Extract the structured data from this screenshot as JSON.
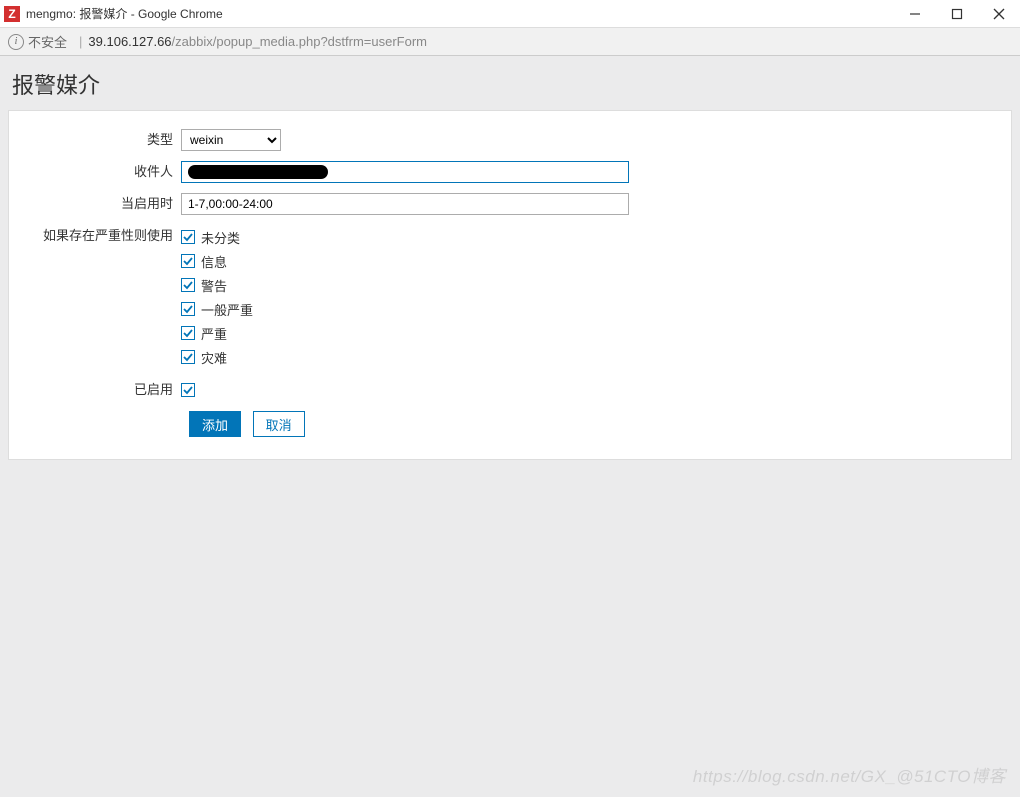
{
  "window": {
    "title": "mengmo: 报警媒介 - Google Chrome",
    "favicon_letter": "Z"
  },
  "address": {
    "insecure_label": "不安全",
    "host": "39.106.127.66",
    "path": "/zabbix/popup_media.php?dstfrm=userForm"
  },
  "page": {
    "title": "报警媒介"
  },
  "form": {
    "type_label": "类型",
    "type_value": "weixin",
    "recipient_label": "收件人",
    "when_active_label": "当启用时",
    "when_active_value": "1-7,00:00-24:00",
    "severity_label": "如果存在严重性则使用",
    "severities": [
      {
        "label": "未分类",
        "checked": true
      },
      {
        "label": "信息",
        "checked": true
      },
      {
        "label": "警告",
        "checked": true
      },
      {
        "label": "一般严重",
        "checked": true
      },
      {
        "label": "严重",
        "checked": true
      },
      {
        "label": "灾难",
        "checked": true
      }
    ],
    "enabled_label": "已启用",
    "enabled_checked": true,
    "submit_label": "添加",
    "cancel_label": "取消"
  },
  "watermark": "https://blog.csdn.net/GX_@51CTO博客"
}
